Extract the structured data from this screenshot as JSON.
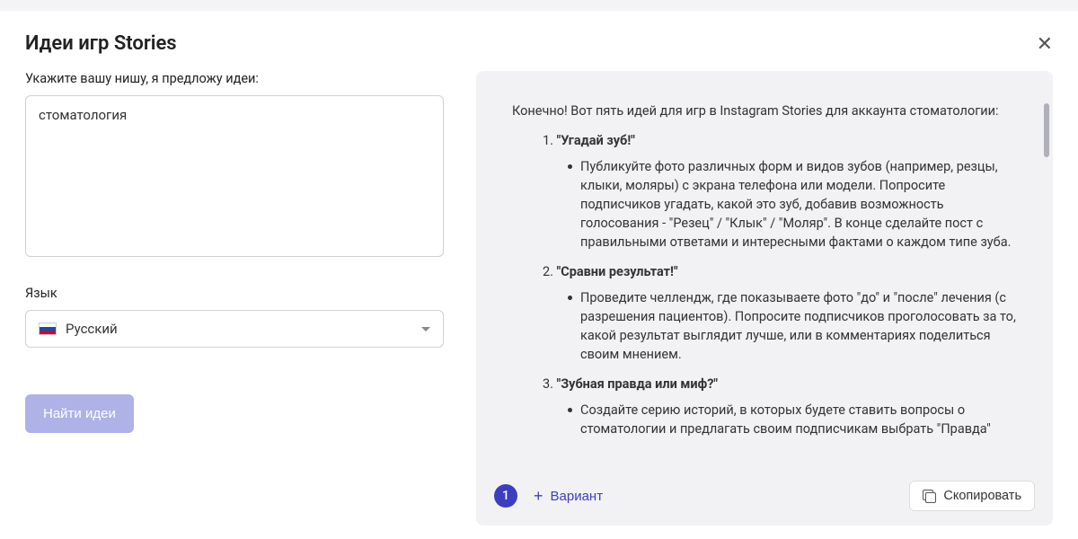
{
  "modal": {
    "title": "Идеи игр Stories"
  },
  "form": {
    "niche_label": "Укажите вашу нишу, я предложу идеи:",
    "niche_value": "стоматология",
    "lang_label": "Язык",
    "lang_value": "Русский",
    "submit_label": "Найти идеи"
  },
  "result": {
    "intro": "Конечно! Вот пять идей для игр в Instagram Stories для аккаунта стоматологии:",
    "ideas": [
      {
        "num": "1.",
        "title": "\"Угадай зуб!\"",
        "desc": "Публикуйте фото различных форм и видов зубов (например, резцы, клыки, моляры) с экрана телефона или модели. Попросите подписчиков угадать, какой это зуб, добавив возможность голосования - \"Резец\" / \"Клык\" / \"Моляр\". В конце сделайте пост с правильными ответами и интересными фактами о каждом типе зуба."
      },
      {
        "num": "2.",
        "title": "\"Сравни результат!\"",
        "desc": "Проведите челлендж, где показываете фото \"до\" и \"после\" лечения (с разрешения пациентов). Попросите подписчиков проголосовать за то, какой результат выглядит лучше, или в комментариях поделиться своим мнением."
      },
      {
        "num": "3.",
        "title": "\"Зубная правда или миф?\"",
        "desc": "Создайте серию историй, в которых будете ставить вопросы о стоматологии и предлагать своим подписчикам выбрать \"Правда\""
      }
    ],
    "badge": "1",
    "variant_label": "Вариант",
    "copy_label": "Скопировать"
  }
}
